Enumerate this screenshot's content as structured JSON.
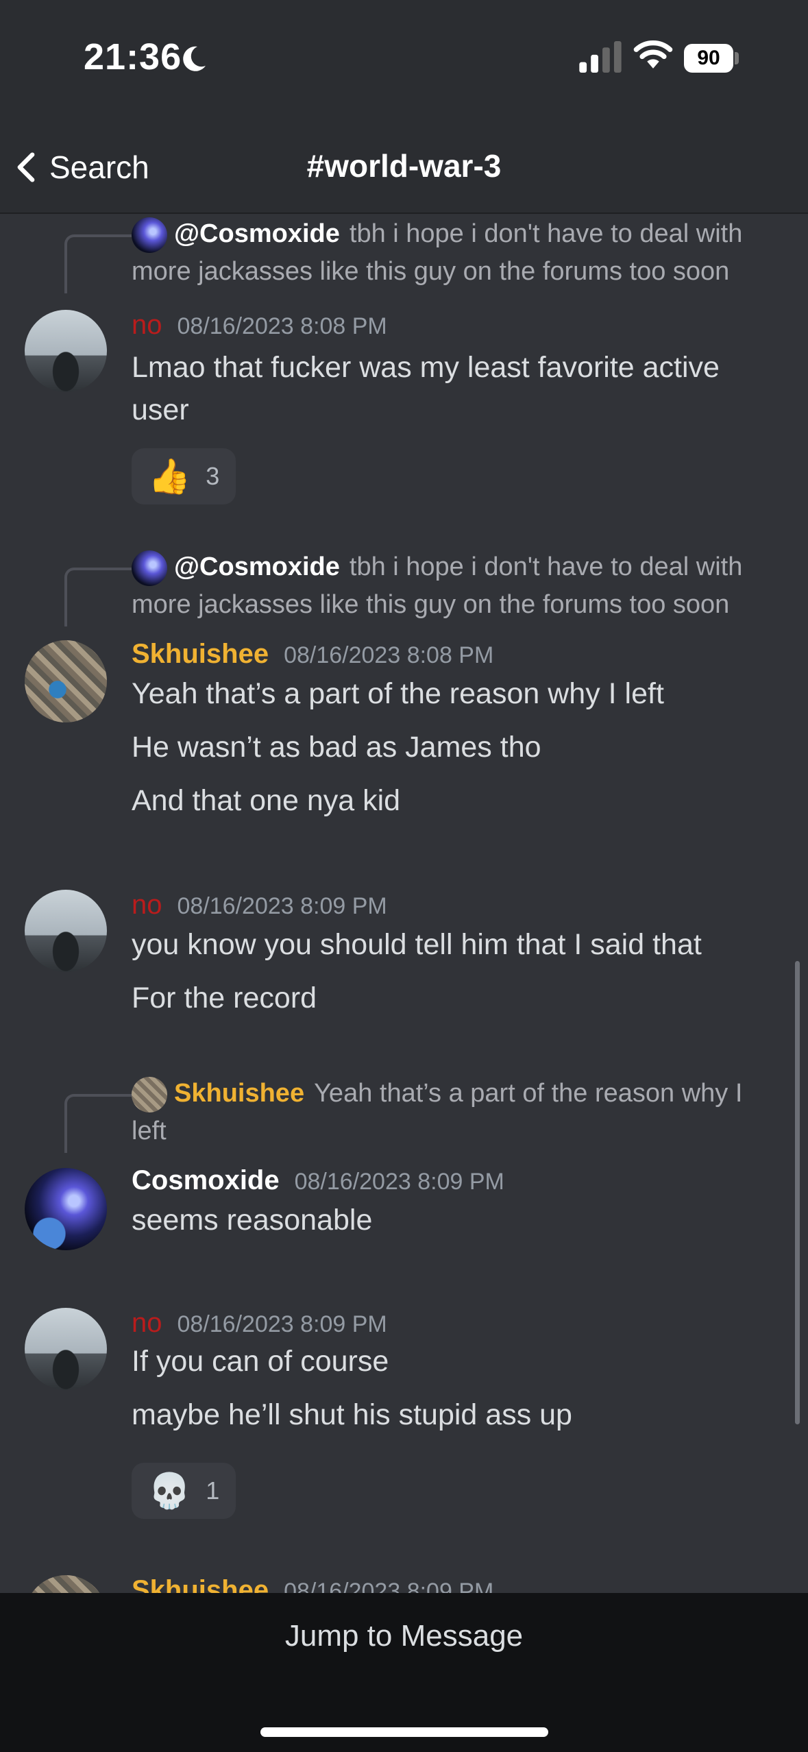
{
  "status": {
    "time": "21:36",
    "battery": "90"
  },
  "nav": {
    "back_label": "Search",
    "channel": "#world-war-3"
  },
  "messages": [
    {
      "reply_to": {
        "user": "@Cosmoxide",
        "text": "tbh i hope i don't have to deal with more jackasses like this guy on the forums too soon"
      },
      "author": "no",
      "timestamp": "08/16/2023 8:08 PM",
      "lines": [
        "Lmao that fucker was my least favorite active",
        "user"
      ],
      "reaction": {
        "emoji": "👍",
        "count": "3"
      }
    },
    {
      "reply_to": {
        "user": "@Cosmoxide",
        "text": "tbh i hope i don't have to deal with more jackasses like this guy on the forums too soon"
      },
      "author": "Skhuishee",
      "timestamp": "08/16/2023 8:08 PM",
      "lines": [
        "Yeah that’s a part of the reason why I left",
        "He wasn’t as bad as James tho",
        "And that one nya kid"
      ]
    },
    {
      "author": "no",
      "timestamp": "08/16/2023 8:09 PM",
      "lines": [
        "you know you should tell him that I said that",
        "For the record"
      ]
    },
    {
      "reply_to": {
        "user": "Skhuishee",
        "text": "Yeah that’s a part of the reason why I left"
      },
      "author": "Cosmoxide",
      "timestamp": "08/16/2023 8:09 PM",
      "lines": [
        "seems reasonable"
      ]
    },
    {
      "author": "no",
      "timestamp": "08/16/2023 8:09 PM",
      "lines": [
        "If you can of course",
        "maybe he’ll shut his stupid ass up"
      ],
      "reaction": {
        "emoji": "💀",
        "count": "1"
      }
    },
    {
      "author": "Skhuishee",
      "timestamp": "08/16/2023 8:09 PM"
    }
  ],
  "footer": {
    "jump_label": "Jump to Message"
  },
  "colors": {
    "background": "#313338",
    "username_red": "#b91c1c",
    "username_gold": "#f0b232"
  }
}
